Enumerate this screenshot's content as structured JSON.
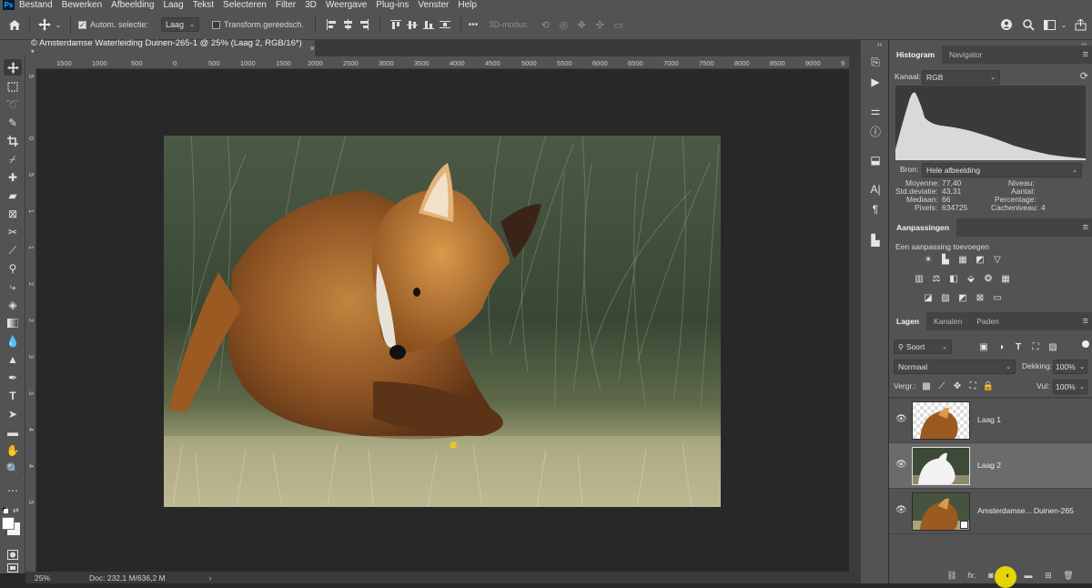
{
  "app": {
    "logo": "Ps"
  },
  "menu": [
    "Bestand",
    "Bewerken",
    "Afbeelding",
    "Laag",
    "Tekst",
    "Selecteren",
    "Filter",
    "3D",
    "Weergave",
    "Plug-ins",
    "Venster",
    "Help"
  ],
  "options": {
    "auto_select_label": "Autom. selectie:",
    "auto_select_value": "Laag",
    "transform_label": "Transform.gereedsch.",
    "more": "•••",
    "mode_3d": "3D-modus:"
  },
  "document": {
    "tab_title": "© Amsterdamse Waterleiding Duinen-265-1 @ 25% (Laag 2, RGB/16*) *",
    "close": "×"
  },
  "ruler": {
    "h_labels": [
      "1500",
      "1000",
      "500",
      "0",
      "500",
      "1000",
      "1500",
      "2000",
      "2500",
      "3000",
      "3500",
      "4000",
      "4500",
      "5000",
      "5500",
      "6000",
      "6500",
      "7000",
      "7500",
      "8000",
      "8500",
      "9000",
      "9"
    ],
    "v_labels": [
      "5",
      "0",
      "5",
      "1",
      "1",
      "2",
      "2",
      "3",
      "3",
      "4",
      "4",
      "5"
    ]
  },
  "status": {
    "zoom": "25%",
    "doc": "Doc: 232,1 M/636,2 M",
    "arrow": "›"
  },
  "histogram": {
    "tabs": [
      "Histogram",
      "Navigator"
    ],
    "channel_label": "Kanaal:",
    "channel_value": "RGB",
    "source_label": "Bron:",
    "source_value": "Hele afbeelding",
    "stats_left": [
      {
        "label": "Moyenne:",
        "value": "77,40"
      },
      {
        "label": "Std.deviatie:",
        "value": "43,31"
      },
      {
        "label": "Mediaan:",
        "value": "66"
      },
      {
        "label": "Pixels:",
        "value": "634725"
      }
    ],
    "stats_right": [
      {
        "label": "Niveau:",
        "value": ""
      },
      {
        "label": "Aantal:",
        "value": ""
      },
      {
        "label": "Percentage:",
        "value": ""
      },
      {
        "label": "Cacheniveau:",
        "value": "4"
      }
    ]
  },
  "adjustments": {
    "tab": "Aanpassingen",
    "hint": "Een aanpassing toevoegen"
  },
  "layers": {
    "tabs": [
      "Lagen",
      "Kanalen",
      "Paden"
    ],
    "filter_value": "Soort",
    "blend_mode": "Normaal",
    "opacity_label": "Dekking:",
    "opacity_value": "100%",
    "lock_label": "Vergr.:",
    "fill_label": "Vul:",
    "fill_value": "100%",
    "items": [
      {
        "name": "Laag 1",
        "selected": false
      },
      {
        "name": "Laag 2",
        "selected": true
      },
      {
        "name": "Amsterdamse... Duinen-265",
        "selected": false
      }
    ],
    "footer_fx": "fx."
  },
  "colors": {
    "bg_dark": "#282828",
    "panel": "#535353",
    "selected_layer": "#6b6b6b",
    "cursor_highlight": "#f3e300"
  }
}
